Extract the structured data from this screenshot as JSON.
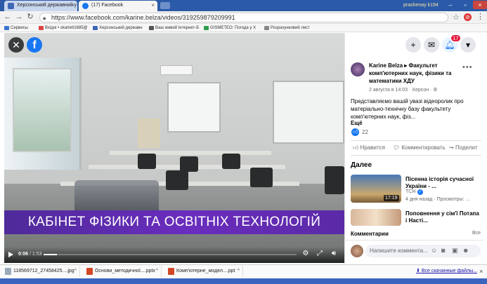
{
  "browser": {
    "tabs": [
      {
        "title": "Херсонський державний у"
      },
      {
        "title": "(17) Facebook"
      }
    ],
    "user_chip": "prashenay k194",
    "address": "https://www.facebook.com/karine.belza/videos/319259879209991",
    "bookmarks": [
      "Сервисы",
      "Вхідні • skarlett1685@",
      "Херсонський державн",
      "Ваш живий Інтернет-Б",
      "GISMETEO: Погода у Х",
      "Розрахунковий лист"
    ]
  },
  "video": {
    "banner": "КАБІНЕТ ФІЗИКИ ТА ОСВІТНІХ ТЕХНОЛОГІЙ",
    "fb_logo": "f",
    "time_current": "0:06",
    "time_total": "/ 1:53",
    "progress": 0.053
  },
  "header": {
    "notifications_count": "17"
  },
  "post": {
    "author": "Karine Belza ▸ Факультет комп'ютерних наук, фізики та математики ХДУ",
    "meta": "2 августа в 14:03 · Херсон · ⚙",
    "text": "Представляємо вашій увазі відеоролик про матеріально-технічну базу факультету комп'ютерних наук, фіз...",
    "more": "Ещё",
    "likes": "22",
    "actions": {
      "like": "Нравится",
      "comment": "Комментировать",
      "share": "Поделит"
    }
  },
  "next": {
    "heading": "Далее",
    "videos": [
      {
        "title": "Пісенна історія сучасної України - ...",
        "duration": "17:19",
        "channel": "ТСН",
        "meta": "4 дня назад · Просмотры: ..."
      },
      {
        "title": "Поповнення у сім'ї Потапа і Насті..."
      }
    ]
  },
  "comments": {
    "heading": "Комментарии",
    "side": "Все",
    "placeholder": "Напишите коммента..."
  },
  "downloads": {
    "items": [
      "118569712_27458425....jpg",
      "Основи_методичної....pptx",
      "Комп'ютерне_модел....ppt"
    ],
    "show_all": "Все скачанные файлы..."
  }
}
